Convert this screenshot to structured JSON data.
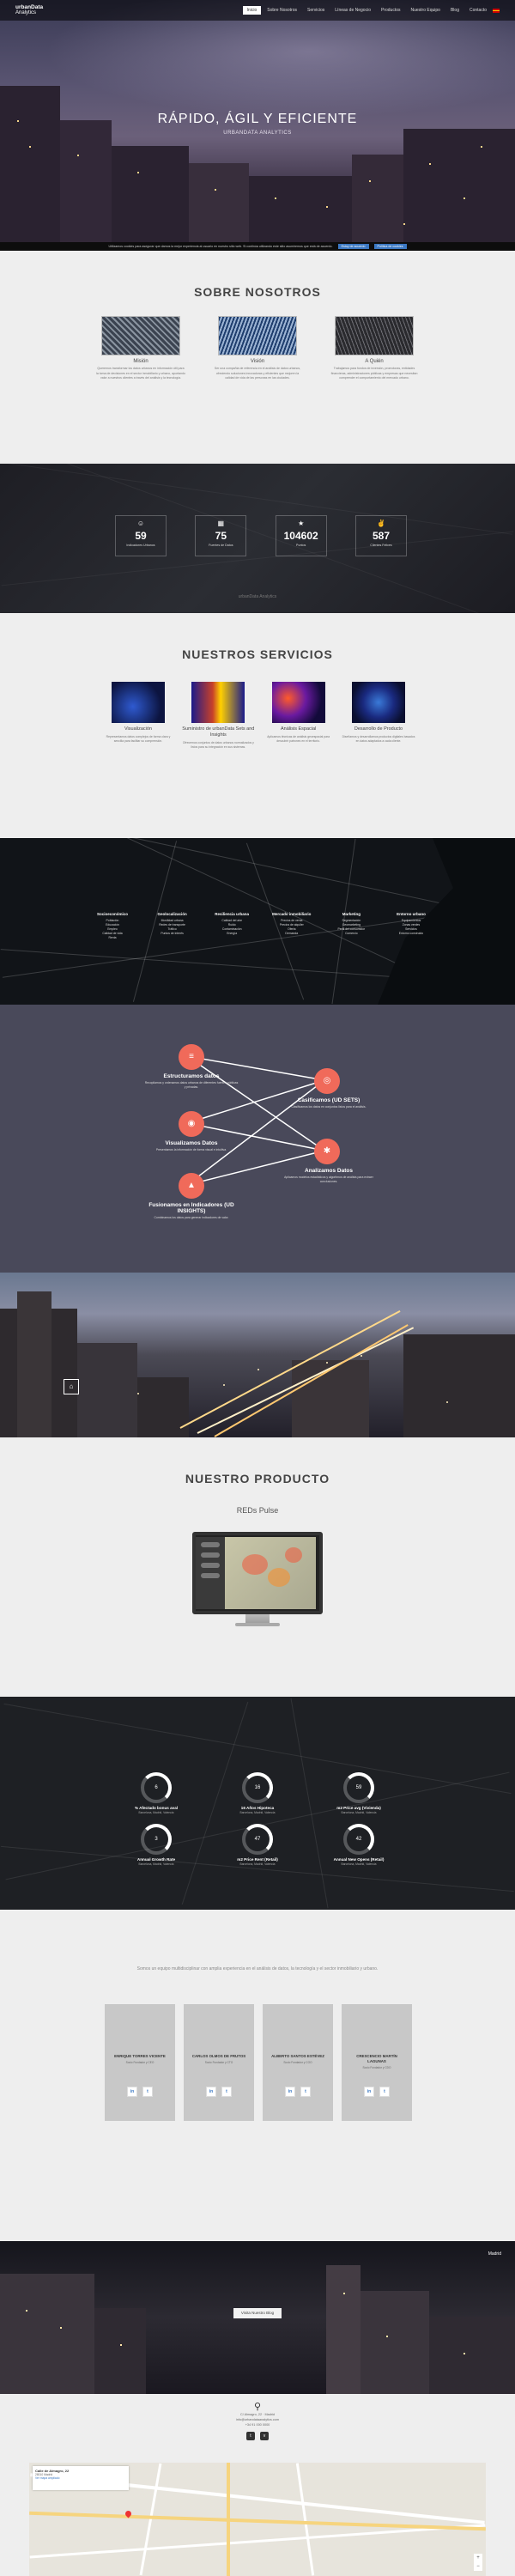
{
  "nav": {
    "logo_line1": "urbanData",
    "logo_line2": "Analytics",
    "items": [
      "Inicio",
      "Sobre Nosotros",
      "Servicios",
      "Líneas de Negocio",
      "Productos",
      "Nuestro Equipo",
      "Blog",
      "Contacto"
    ],
    "active": 0
  },
  "hero": {
    "title": "RÁPIDO, ÁGIL Y EFICIENTE",
    "subtitle": "URBANDATA ANALYTICS"
  },
  "cookie": {
    "text": "Utilizamos cookies para asegurar que damos la mejor experiencia al usuario en nuestro sitio web. Si continúa utilizando este sitio asumiremos que está de acuerdo.",
    "accept": "Estoy de acuerdo",
    "more": "Política de cookies"
  },
  "about": {
    "title": "SOBRE NOSOTROS",
    "cols": [
      {
        "heading": "Misión",
        "text": "Queremos transformar los datos urbanos en información útil para la toma de decisiones en el sector inmobiliario y urbano, aportando valor a nuestros clientes a través del análisis y la tecnología."
      },
      {
        "heading": "Visión",
        "text": "Ser una compañía de referencia en el análisis de datos urbanos, ofreciendo soluciones innovadoras y eficientes que mejoren la calidad de vida de las personas en las ciudades."
      },
      {
        "heading": "A Quién",
        "text": "Trabajamos para fondos de inversión, promotoras, entidades financieras, administraciones públicas y empresas que necesitan comprender el comportamiento del mercado urbano."
      }
    ]
  },
  "stats": {
    "items": [
      {
        "icon": "user-icon",
        "value": "59",
        "label": "Indicadores Urbanos"
      },
      {
        "icon": "grid-icon",
        "value": "75",
        "label": "Fuentes de Datos"
      },
      {
        "icon": "star-icon",
        "value": "104602",
        "label": "Puntos"
      },
      {
        "icon": "thumbs-up-icon",
        "value": "587",
        "label": "Clientes Felices"
      }
    ],
    "footer": "urbanData Analytics"
  },
  "services": {
    "title": "NUESTROS SERVICIOS",
    "cols": [
      {
        "heading": "Visualización",
        "text": "Representamos datos complejos de forma clara y sencilla para facilitar su comprensión."
      },
      {
        "heading": "Suministro de urbanData Sets and Insights",
        "text": "Ofrecemos conjuntos de datos urbanos normalizados y listos para su integración en sus sistemas."
      },
      {
        "heading": "Análisis Espacial",
        "text": "Aplicamos técnicas de análisis geoespacial para descubrir patrones en el territorio."
      },
      {
        "heading": "Desarrollo de Producto",
        "text": "Diseñamos y desarrollamos productos digitales basados en datos adaptados a cada cliente."
      }
    ]
  },
  "lines": {
    "cols": [
      {
        "heading": "Socioeconómico",
        "items": [
          "Población",
          "Educación",
          "Empleo",
          "Calidad de vida",
          "Renta"
        ]
      },
      {
        "heading": "Geolocalización",
        "items": [
          "Movilidad urbana",
          "Redes de transporte",
          "Tráfico",
          "Puntos de interés"
        ]
      },
      {
        "heading": "Resiliencia urbana",
        "items": [
          "Calidad del aire",
          "Ruido",
          "Contaminación",
          "Energía"
        ]
      },
      {
        "heading": "Mercado inmobiliario",
        "items": [
          "Precios de venta",
          "Precios de alquiler",
          "Oferta",
          "Demanda"
        ]
      },
      {
        "heading": "Marketing",
        "items": [
          "Segmentación",
          "Geomarketing",
          "Perfil del consumidor",
          "Comercio"
        ]
      },
      {
        "heading": "Entorno urbano",
        "items": [
          "Equipamientos",
          "Zonas verdes",
          "Servicios",
          "Entorno construido"
        ]
      }
    ]
  },
  "process": {
    "nodes": [
      {
        "icon": "layers-icon",
        "glyph": "≡",
        "heading": "Estructuramos datos",
        "text": "Recopilamos y ordenamos datos urbanos de diferentes fuentes públicas y privadas."
      },
      {
        "icon": "eye-icon",
        "glyph": "◉",
        "heading": "Visualizamos Datos",
        "text": "Presentamos la información de forma visual e intuitiva."
      },
      {
        "icon": "chart-icon",
        "glyph": "▲",
        "heading": "Fusionamos en Indicadores (UD INSIGHTS)",
        "text": "Combinamos los datos para generar indicadores de valor."
      },
      {
        "icon": "target-icon",
        "glyph": "◎",
        "heading": "Casificamos (UD SETS)",
        "text": "Clasificamos los datos en conjuntos listos para el análisis."
      },
      {
        "icon": "gear-icon",
        "glyph": "✱",
        "heading": "Analizamos Datos",
        "text": "Aplicamos modelos estadísticos y algoritmos de análisis para extraer conclusiones."
      }
    ]
  },
  "product": {
    "title": "NUESTRO PRODUCTO",
    "name": "REDs Pulse"
  },
  "dashboard": {
    "gauges": [
      {
        "value": "6",
        "label": "% Afectado bonus aval",
        "sub": "Barcelona, Madrid, Valencia"
      },
      {
        "value": "16",
        "label": "16 Años Hipoteca",
        "sub": "Barcelona, Madrid, Valencia"
      },
      {
        "value": "59",
        "label": "m2 Price avg (Vivienda)",
        "sub": "Barcelona, Madrid, Valencia"
      },
      {
        "value": "3",
        "label": "Annual Growth Rate",
        "sub": "Barcelona, Madrid, Valencia"
      },
      {
        "value": "47",
        "label": "m2 Price Rent (Retail)",
        "sub": "Barcelona, Madrid, Valencia"
      },
      {
        "value": "42",
        "label": "Annual New Opens (Retail)",
        "sub": "Barcelona, Madrid, Valencia"
      }
    ]
  },
  "team": {
    "intro": "Somos un equipo multidisciplinar con amplia experiencia en el análisis de datos, la tecnología y el sector inmobiliario y urbano.",
    "members": [
      {
        "name": "ENRIQUE TORRES VICENTE",
        "role": "Socio Fundador y CEO"
      },
      {
        "name": "CARLOS OLMOS DE FRUTOS",
        "role": "Socio Fundador y CTO"
      },
      {
        "name": "ALBERTO SANTOS ESTÉVEZ",
        "role": "Socio Fundador y COO"
      },
      {
        "name": "CRESCENCIO MARTÍN LAGUNAS",
        "role": "Socio Fundador y CDO"
      }
    ]
  },
  "blog": {
    "button": "Visita Nuestro Blog",
    "tag": "Madrid"
  },
  "contact": {
    "address": "C/ Almagro, 22 · Madrid",
    "email": "info@urbandataanalytics.com",
    "phone": "+34 91 000 0000",
    "map_title": "Calle de Almagro, 22",
    "map_sub": "28010 Madrid",
    "map_link": "Ver mapa ampliado"
  }
}
